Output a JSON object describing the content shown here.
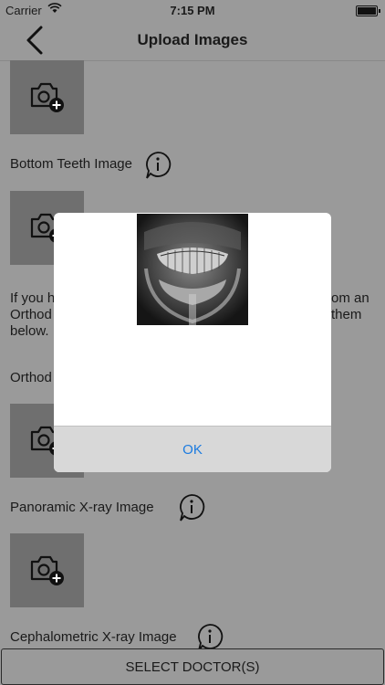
{
  "status_bar": {
    "carrier": "Carrier",
    "time": "7:15 PM"
  },
  "nav": {
    "title": "Upload Images"
  },
  "sections": {
    "bottom_teeth": "Bottom Teeth Image",
    "panoramic": "Panoramic X-ray Image",
    "cephalometric": "Cephalometric X-ray Image"
  },
  "paragraph": {
    "line1_left": "If you h",
    "line1_right": "om an",
    "line2_left": "Orthod",
    "line2_right": "them",
    "line3": "below."
  },
  "orthodontic_label": "Orthod",
  "alert": {
    "image": "panoramic dental x-ray",
    "ok_label": "OK"
  },
  "footer": {
    "select_doctor_label": "SELECT DOCTOR(S)"
  }
}
